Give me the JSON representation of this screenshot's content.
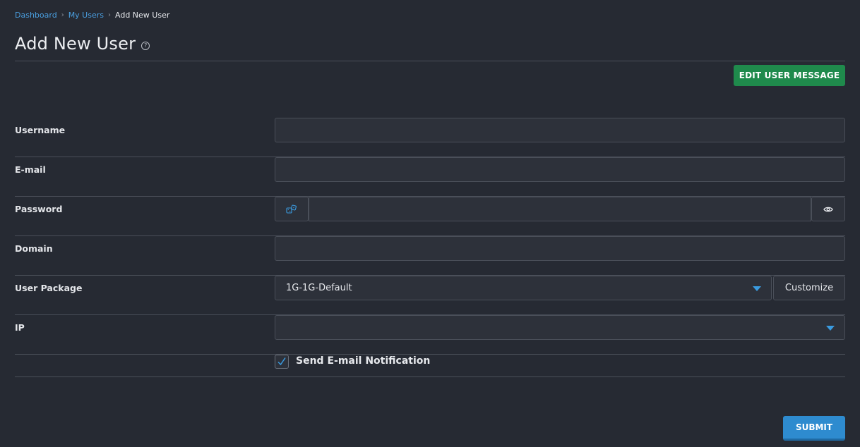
{
  "breadcrumb": {
    "items": [
      "Dashboard",
      "My Users"
    ],
    "current": "Add New User"
  },
  "page": {
    "title": "Add New User"
  },
  "toolbar": {
    "edit_user_message_label": "EDIT USER MESSAGE"
  },
  "form": {
    "username": {
      "label": "Username",
      "value": ""
    },
    "email": {
      "label": "E-mail",
      "value": ""
    },
    "password": {
      "label": "Password",
      "value": ""
    },
    "domain": {
      "label": "Domain",
      "value": ""
    },
    "user_package": {
      "label": "User Package",
      "selected": "1G-1G-Default",
      "customize_label": "Customize"
    },
    "ip": {
      "label": "IP",
      "selected": ""
    },
    "send_notification": {
      "label": "Send E-mail Notification",
      "checked": true
    }
  },
  "submit_label": "SUBMIT",
  "colors": {
    "accent": "#2e8bcf",
    "success": "#1f8a4c",
    "background": "#262a33",
    "link": "#4a9fe0"
  },
  "icons": {
    "password_generate": "dice-icon",
    "password_toggle": "eye-icon",
    "help": "question-circle-icon"
  }
}
